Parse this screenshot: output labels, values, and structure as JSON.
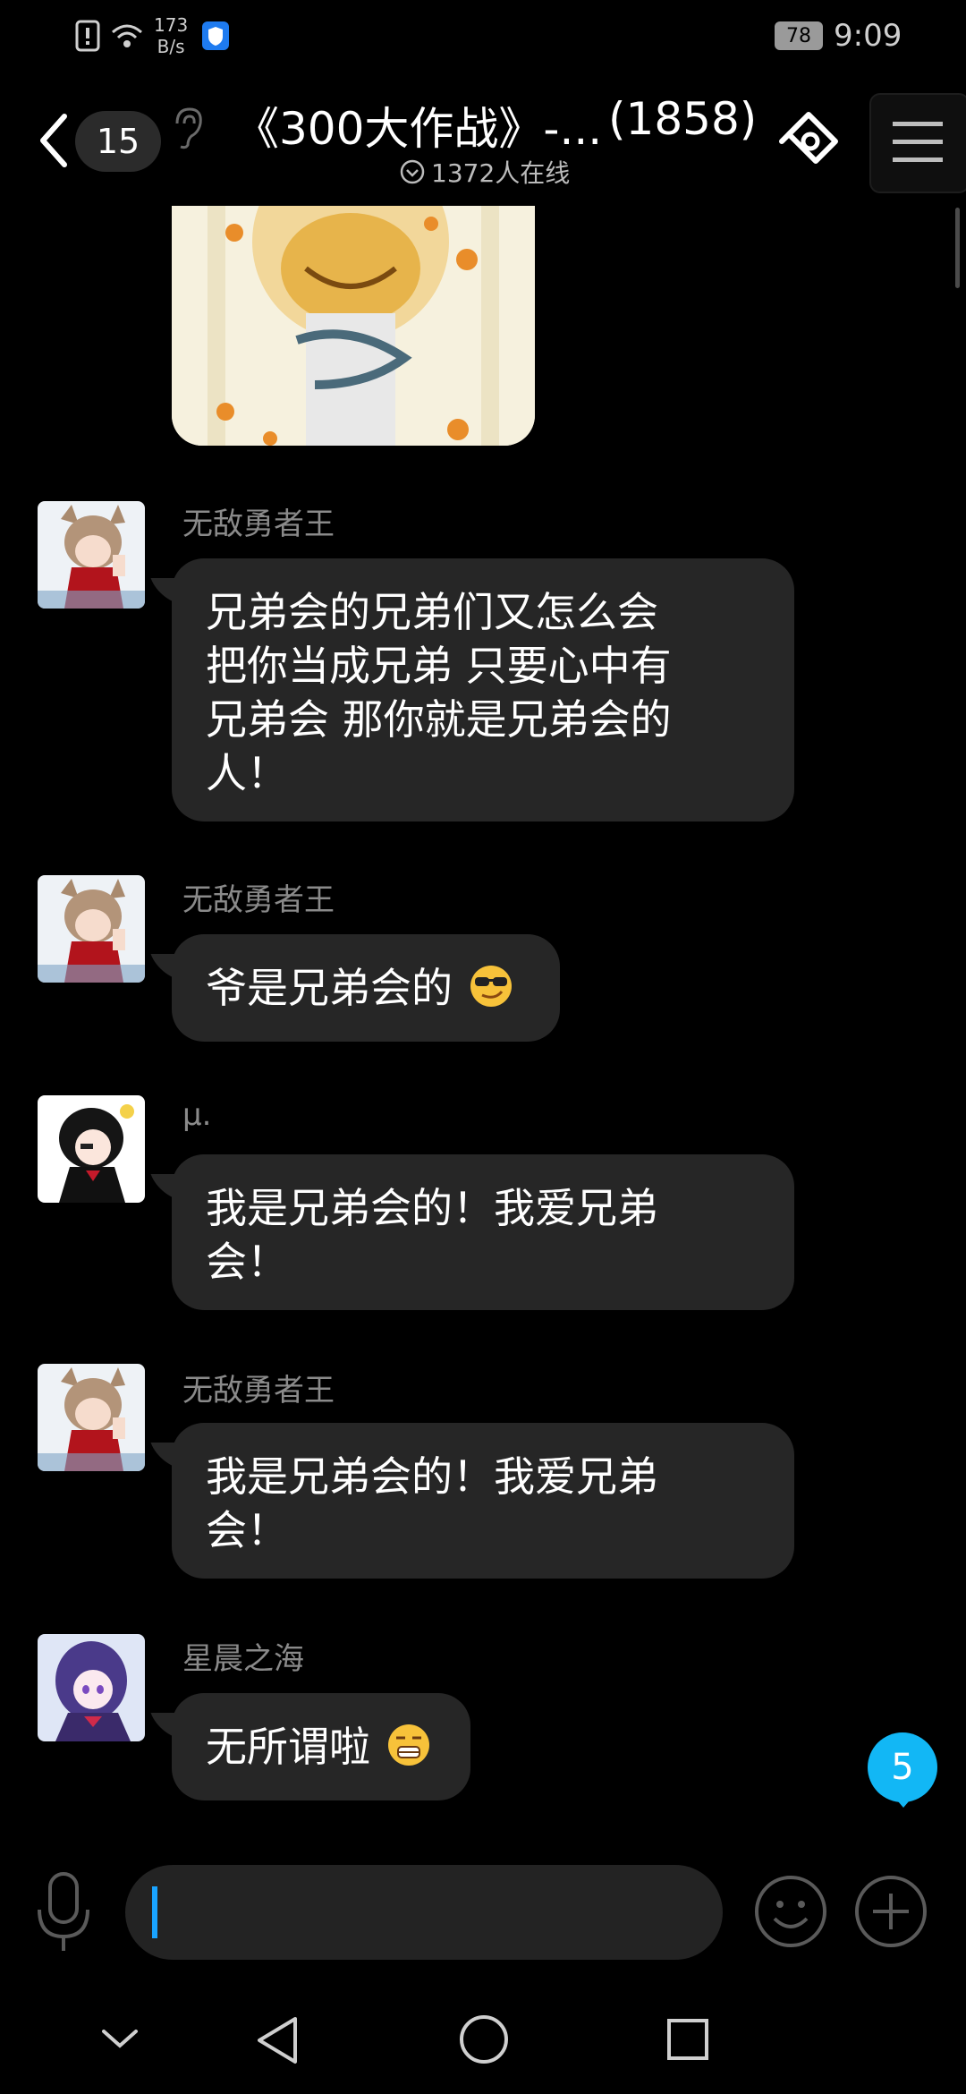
{
  "status_bar": {
    "network_speed_top": "173",
    "network_speed_bottom": "B/s",
    "battery": "78",
    "time": "9:09"
  },
  "header": {
    "back_count": "15",
    "title": "《300大作战》-...",
    "member_count": "(1858)",
    "online": "1372人在线"
  },
  "messages": [
    {
      "sender": "无敌勇者王",
      "text_lines": [
        "兄弟会的兄弟们又怎么会",
        "把你当成兄弟 只要心中有",
        "兄弟会 那你就是兄弟会的",
        "人！"
      ]
    },
    {
      "sender": "无敌勇者王",
      "text": "爷是兄弟会的",
      "emoji": "sunglasses-emoji"
    },
    {
      "sender": "μ.",
      "text_lines": [
        "我是兄弟会的！我爱兄弟",
        "会！"
      ]
    },
    {
      "sender": "无敌勇者王",
      "text_lines": [
        "我是兄弟会的！我爱兄弟",
        "会！"
      ]
    },
    {
      "sender": "星晨之海",
      "text": "无所谓啦",
      "emoji": "grimace-emoji"
    }
  ],
  "unread_badge": "5",
  "colors": {
    "accent": "#12b7f5",
    "bubble": "#262626",
    "background": "#000000",
    "caret": "#19a3ff"
  }
}
